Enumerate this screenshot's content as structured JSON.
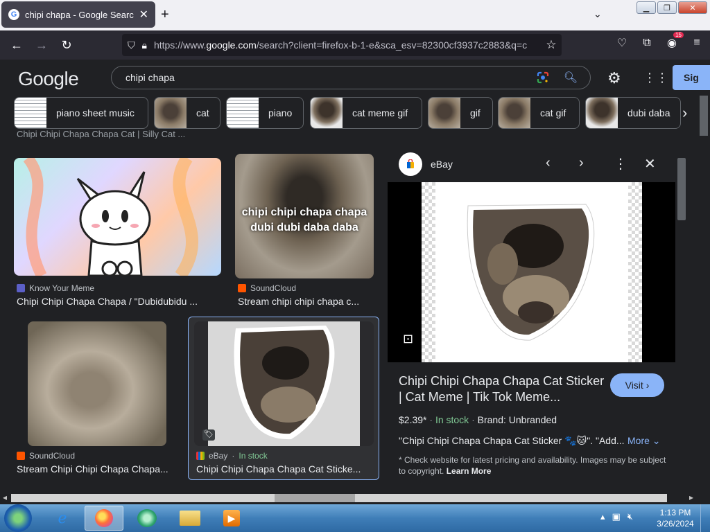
{
  "browser": {
    "tab_title": "chipi chapa - Google Search",
    "tab_favicon": "G",
    "url_prefix": "https://www.",
    "url_host": "google.com",
    "url_rest": "/search?client=firefox-b-1-e&sca_esv=82300cf3937c2883&q=c",
    "extension_badge": "15"
  },
  "google": {
    "logo": "Google",
    "query": "chipi chapa",
    "signin_label": "Sig"
  },
  "chips": [
    {
      "label": "piano sheet music"
    },
    {
      "label": "cat"
    },
    {
      "label": "piano"
    },
    {
      "label": "cat meme gif"
    },
    {
      "label": "gif"
    },
    {
      "label": "cat gif"
    },
    {
      "label": "dubi daba"
    }
  ],
  "cutoff_text": "Chipi Chipi Chapa Chapa Cat | Silly Cat ...",
  "results": [
    {
      "source": "Know Your Meme",
      "title": "Chipi Chipi Chapa Chapa / \"Dubidubidu ..."
    },
    {
      "source": "SoundCloud",
      "title": "Stream chipi chipi chapa c...",
      "overlay": "chipi chipi chapa chapa dubi dubi daba daba"
    },
    {
      "source": "SoundCloud",
      "title": "Stream Chipi Chipi Chapa Chapa..."
    },
    {
      "source": "eBay",
      "stock": "In stock",
      "title": "Chipi Chipi Chapa Chapa Cat Sticke..."
    }
  ],
  "panel": {
    "source": "eBay",
    "title": "Chipi Chipi Chapa Chapa Cat Sticker | Cat Meme | Tik Tok Meme...",
    "visit_label": "Visit",
    "price": "$2.39*",
    "stock": "In stock",
    "brand": "Brand: Unbranded",
    "description": "\"Chipi Chipi Chapa Chapa Cat Sticker 🐾🐱\". \"Add...",
    "more_label": "More",
    "disclaimer": "* Check website for latest pricing and availability. Images may be subject to copyright.",
    "learn_more": "Learn More"
  },
  "taskbar": {
    "time": "1:13 PM",
    "date": "3/26/2024"
  },
  "colors": {
    "accent": "#8ab4f8",
    "in_stock": "#81c995",
    "background": "#202124"
  }
}
